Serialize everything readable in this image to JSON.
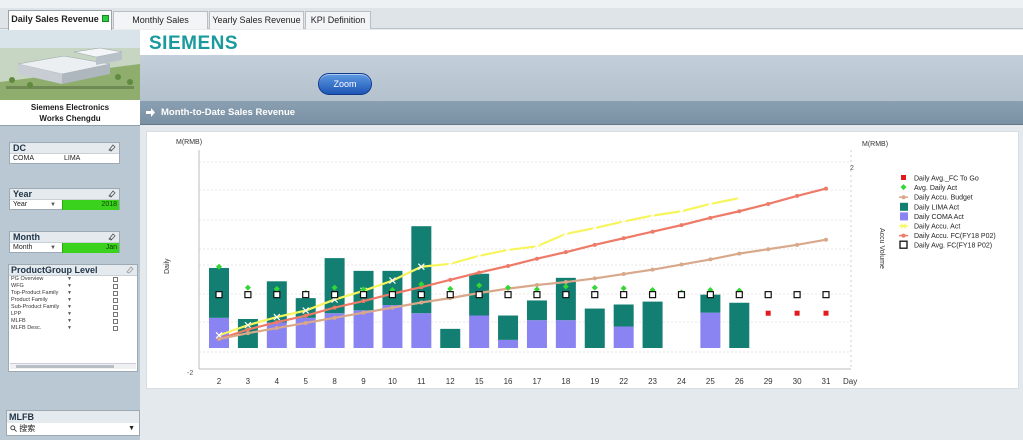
{
  "tabs": [
    {
      "label": "Daily Sales Revenue",
      "active": true
    },
    {
      "label": "Monthly Sales Revenue",
      "active": false
    },
    {
      "label": "Yearly Sales Revenue",
      "active": false
    },
    {
      "label": "KPI Definition",
      "active": false
    }
  ],
  "brand": {
    "logo_text": "SIEMENS",
    "color": "#1a9a9e"
  },
  "sidebar": {
    "plant_caption_line1": "Siemens Electronics",
    "plant_caption_line2": "Works Chengdu",
    "dc": {
      "title": "DC",
      "values": [
        "COMA",
        "LIMA"
      ]
    },
    "year": {
      "title": "Year",
      "field": "Year",
      "value": "2018"
    },
    "month": {
      "title": "Month",
      "field": "Month",
      "value": "Jan"
    },
    "product_group": {
      "title": "ProductGroup Level",
      "rows": [
        "PG Overview",
        "WFG",
        "Top-Product Family",
        "Product Family",
        "Sub-Product Family",
        "LPP",
        "MLFB",
        "MLFB Desc."
      ]
    },
    "mlfb": {
      "title": "MLFB",
      "search_placeholder": "搜索"
    }
  },
  "zoom_button_label": "Zoom",
  "section_title": "Month-to-Date Sales Revenue",
  "chart_data": {
    "type": "bar",
    "left_axis_unit": "M(RMB)",
    "right_axis_unit": "M(RMB)",
    "left_axis_title": "Daily",
    "right_axis_title": "Accu Volume",
    "x_axis_title": "Day",
    "categories": [
      "2",
      "3",
      "4",
      "5",
      "8",
      "9",
      "10",
      "11",
      "12",
      "15",
      "16",
      "17",
      "18",
      "19",
      "22",
      "23",
      "24",
      "25",
      "26",
      "29",
      "30",
      "31"
    ],
    "left_ticks": [
      "",
      "-2"
    ],
    "right_ticks": [
      "2",
      ""
    ],
    "legend": [
      {
        "label": "Daily Avg._FC To Go",
        "marker": "square",
        "color": "#e31a1c"
      },
      {
        "label": "Avg. Daily Act",
        "marker": "diamond",
        "color": "#33d633"
      },
      {
        "label": "Daily Accu. Budget",
        "marker": "line-dot",
        "color": "#d9a88a"
      },
      {
        "label": "Daily LIMA  Act",
        "marker": "box",
        "color": "#127f72"
      },
      {
        "label": "Daily COMA  Act",
        "marker": "box",
        "color": "#8a83f2"
      },
      {
        "label": "Daily Accu. Act",
        "marker": "line-star",
        "color": "#f7f55e"
      },
      {
        "label": "Daily Accu. FC(FY18 P02)",
        "marker": "line-dot",
        "color": "#ee7a68"
      },
      {
        "label": "Daily Avg. FC(FY18 P02)",
        "marker": "hollow-square",
        "color": "#111111"
      }
    ],
    "series": [
      {
        "name": "Daily LIMA  Act",
        "kind": "stack",
        "color": "#127f72",
        "values": [
          0.86,
          0.5,
          0.71,
          0.34,
          0.95,
          0.68,
          0.59,
          1.5,
          0.33,
          0.72,
          0.42,
          0.34,
          0.73,
          0.68,
          0.38,
          0.8,
          0,
          0.31,
          0.78,
          null,
          null,
          null
        ]
      },
      {
        "name": "Daily COMA  Act",
        "kind": "stack",
        "color": "#8a83f2",
        "values": [
          0.52,
          0.0,
          0.44,
          0.52,
          0.6,
          0.65,
          0.74,
          0.6,
          0.0,
          0.56,
          0.14,
          0.48,
          0.48,
          0.0,
          0.37,
          0.0,
          0,
          0.61,
          0.0,
          null,
          null,
          null
        ]
      },
      {
        "name": "Avg. Daily Act",
        "kind": "marker",
        "color": "#33d633",
        "values": [
          1.4,
          1.04,
          1.02,
          0.95,
          1.04,
          1.01,
          1.0,
          1.1,
          1.02,
          1.08,
          1.04,
          1.01,
          1.06,
          1.04,
          1.03,
          1.0,
          0.96,
          1.0,
          0.99,
          null,
          null,
          null
        ]
      },
      {
        "name": "Daily Avg. FC(FY18 P02)",
        "kind": "marker",
        "color": "#111111",
        "values": [
          0.92,
          0.92,
          0.92,
          0.92,
          0.92,
          0.92,
          0.92,
          0.92,
          0.92,
          0.92,
          0.92,
          0.92,
          0.92,
          0.92,
          0.92,
          0.92,
          0.92,
          0.92,
          0.92,
          0.92,
          0.92,
          0.92
        ]
      },
      {
        "name": "Daily Avg._FC To Go",
        "kind": "marker",
        "color": "#e31a1c",
        "values": [
          null,
          null,
          null,
          null,
          null,
          null,
          null,
          null,
          null,
          null,
          null,
          null,
          null,
          null,
          null,
          null,
          null,
          null,
          null,
          0.6,
          0.6,
          0.6
        ]
      },
      {
        "name": "Daily Accu. Act",
        "kind": "line",
        "color": "#f7f55e",
        "values": [
          0.5,
          1.9,
          3.0,
          3.9,
          5.4,
          6.6,
          8.0,
          9.9,
          10.3,
          11.4,
          12.2,
          12.7,
          14.4,
          15.2,
          16.1,
          16.9,
          17.5,
          18.5,
          19.3,
          null,
          null,
          null
        ]
      },
      {
        "name": "Daily Accu. FC(FY18 P02)",
        "kind": "line",
        "color": "#ee7a68",
        "values": [
          0.0,
          1.3,
          2.3,
          3.2,
          4.3,
          5.2,
          6.2,
          7.1,
          8.1,
          9.1,
          10.0,
          11.0,
          11.9,
          12.9,
          13.8,
          14.7,
          15.6,
          16.6,
          17.5,
          18.5,
          19.6,
          20.6
        ]
      },
      {
        "name": "Daily Accu. Budget",
        "kind": "line",
        "color": "#d9a88a",
        "values": [
          0.0,
          0.8,
          1.5,
          2.2,
          2.9,
          3.6,
          4.3,
          5.0,
          5.6,
          6.3,
          6.9,
          7.4,
          7.8,
          8.3,
          8.9,
          9.5,
          10.2,
          10.9,
          11.7,
          12.3,
          12.9,
          13.6
        ]
      }
    ]
  }
}
